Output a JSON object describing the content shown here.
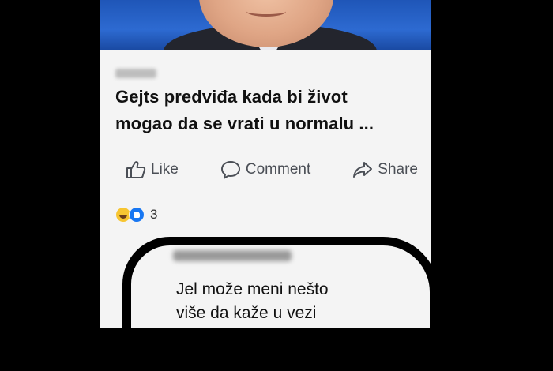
{
  "post": {
    "headline_line1": "Gejts predviđa kada bi život",
    "headline_line2": "mogao da se vrati u normalu ..."
  },
  "actions": {
    "like": "Like",
    "comment": "Comment",
    "share": "Share"
  },
  "reactions": {
    "count": "3",
    "types": [
      "haha",
      "like"
    ]
  },
  "comment": {
    "line1": "Jel može meni nešto",
    "line2": "više da kaže u vezi"
  },
  "colors": {
    "background": "#000000",
    "card": "#f4f4f4",
    "action_text": "#4b4f56",
    "like_blue": "#1877f2",
    "haha_yellow": "#f7c531"
  }
}
